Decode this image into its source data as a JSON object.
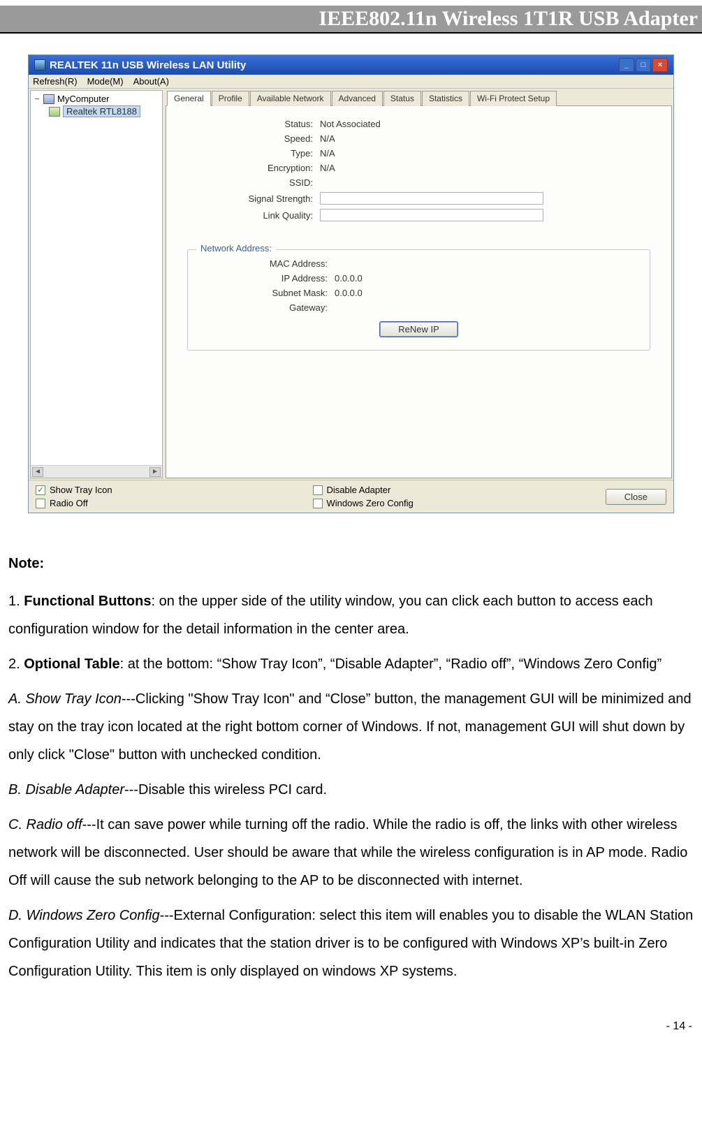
{
  "header": {
    "title": "IEEE802.11n Wireless 1T1R USB Adapter"
  },
  "window": {
    "title": "REALTEK 11n USB Wireless LAN Utility",
    "menu": {
      "refresh": "Refresh(R)",
      "mode": "Mode(M)",
      "about": "About(A)"
    },
    "tree": {
      "root": "MyComputer",
      "child": "Realtek RTL8188"
    },
    "tabs": {
      "general": "General",
      "profile": "Profile",
      "available_network": "Available Network",
      "advanced": "Advanced",
      "status": "Status",
      "statistics": "Statistics",
      "wps": "Wi-Fi Protect Setup"
    },
    "general": {
      "status_label": "Status:",
      "status_value": "Not Associated",
      "speed_label": "Speed:",
      "speed_value": "N/A",
      "type_label": "Type:",
      "type_value": "N/A",
      "encryption_label": "Encryption:",
      "encryption_value": "N/A",
      "ssid_label": "SSID:",
      "ssid_value": "",
      "signal_label": "Signal Strength:",
      "link_label": "Link Quality:"
    },
    "network_address": {
      "legend": "Network Address:",
      "mac_label": "MAC Address:",
      "mac_value": "",
      "ip_label": "IP Address:",
      "ip_value": "0.0.0.0",
      "subnet_label": "Subnet Mask:",
      "subnet_value": "0.0.0.0",
      "gateway_label": "Gateway:",
      "gateway_value": "",
      "renew_button": "ReNew IP"
    },
    "bottom": {
      "show_tray": "Show Tray Icon",
      "radio_off": "Radio Off",
      "disable_adapter": "Disable Adapter",
      "windows_zero": "Windows Zero Config",
      "close": "Close"
    }
  },
  "doc": {
    "note": "Note:",
    "p1_prefix": "1. ",
    "p1_bold": "Functional Buttons",
    "p1_rest": ": on the upper side of the utility window, you can click each button to access each configuration window for the detail information in the center area.",
    "p2_prefix": "2. ",
    "p2_bold": "Optional Table",
    "p2_rest": ": at the bottom: “Show Tray Icon”, “Disable Adapter”, “Radio off”, “Windows Zero Config”",
    "a_label": "A. Show Tray Icon",
    "a_rest": "---Clicking \"Show Tray Icon\" and “Close” button, the management GUI will be minimized and stay on the tray icon located at the right bottom corner of Windows. If not, management GUI will shut down by only click \"Close\" button with unchecked condition.",
    "b_label": "B. Disable Adapter",
    "b_rest": "---Disable this wireless PCI card.",
    "c_label": "C. Radio off",
    "c_rest": "---It can save power while turning off the radio. While the radio is off, the links with other wireless network will be disconnected. User should be aware that while the wireless configuration is in AP mode. Radio Off will cause the sub network belonging to the AP to be disconnected with internet.",
    "d_label": "D. Windows Zero Config",
    "d_rest": "---External Configuration: select this item will enables you to disable the WLAN Station Configuration Utility and indicates that the station driver is to be configured with Windows XP’s built-in Zero Configuration Utility. This item is only displayed on windows XP systems.",
    "page_number": "- 14 -"
  }
}
